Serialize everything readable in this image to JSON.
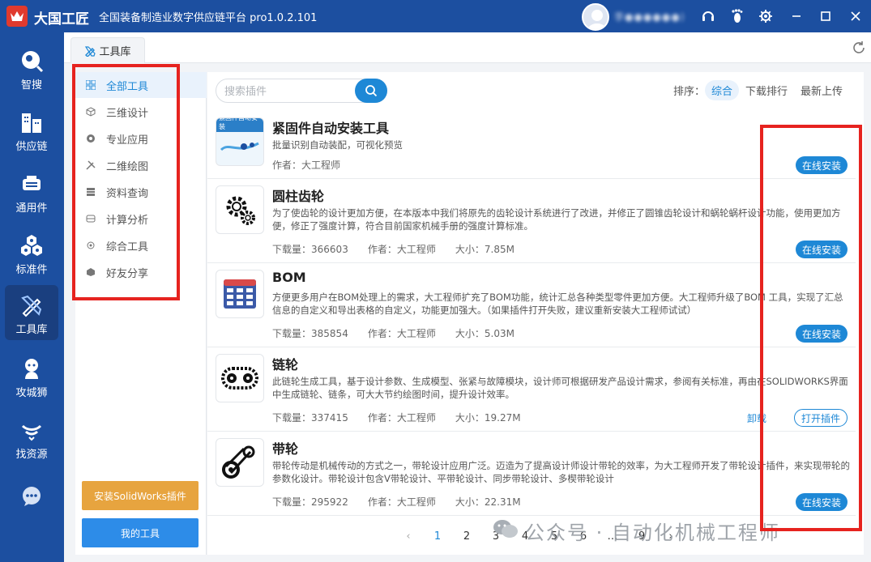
{
  "app": {
    "name": "大国工匠",
    "subtitle": "全国装备制造业数字供应链平台  pro1.0.2.101",
    "username": "李●●●●●●)"
  },
  "icons": {
    "logo": "crown-logo",
    "headset": "headset-icon",
    "footprint": "footprint-icon",
    "settings": "gear-icon",
    "minimize": "minimize-icon",
    "maximize": "maximize-icon",
    "close": "close-icon"
  },
  "sidebar": {
    "items": [
      {
        "label": "智搜",
        "icon": "search-bubble-icon"
      },
      {
        "label": "供应链",
        "icon": "buildings-icon"
      },
      {
        "label": "通用件",
        "icon": "component-icon"
      },
      {
        "label": "标准件",
        "icon": "hexagon-nuts-icon"
      },
      {
        "label": "工具库",
        "icon": "ruler-pencil-icon"
      },
      {
        "label": "攻城狮",
        "icon": "mascot-icon"
      },
      {
        "label": "找资源",
        "icon": "resource-icon"
      },
      {
        "label": "",
        "icon": "chat-icon"
      }
    ]
  },
  "tab": {
    "label": "工具库"
  },
  "categories": [
    {
      "label": "全部工具",
      "icon": "grid-icon"
    },
    {
      "label": "三维设计",
      "icon": "cube-icon"
    },
    {
      "label": "专业应用",
      "icon": "aperture-icon"
    },
    {
      "label": "二维绘图",
      "icon": "tools-icon"
    },
    {
      "label": "资料查询",
      "icon": "list-icon"
    },
    {
      "label": "计算分析",
      "icon": "calculator-icon"
    },
    {
      "label": "综合工具",
      "icon": "gear-small-icon"
    },
    {
      "label": "好友分享",
      "icon": "share-icon"
    }
  ],
  "buttons": {
    "install_solidworks": "安装SolidWorks插件",
    "my_tools": "我的工具"
  },
  "search": {
    "placeholder": "搜索插件"
  },
  "sort": {
    "label": "排序：",
    "options": [
      "综合",
      "下载排行",
      "最新上传"
    ]
  },
  "labels": {
    "downloads": "下载量：",
    "author": "作者：",
    "size": "大小：",
    "uninstall": "卸载"
  },
  "items": [
    {
      "name": "紧固件自动安装工具",
      "desc": "批量识别自动装配，可视化预览",
      "downloads": "",
      "author": "大工程师",
      "size": "",
      "action": "在线安装",
      "thumb": "fastener-thumb",
      "thumb_text": "紧固件自动安装"
    },
    {
      "name": "圆柱齿轮",
      "desc": "为了使齿轮的设计更加方便，在本版本中我们将原先的齿轮设计系统进行了改进，并修正了圆锥齿轮设计和蜗轮蜗杆设计功能，使用更加方便，修正了强度计算，符合目前国家机械手册的强度计算标准。",
      "downloads": "366603",
      "author": "大工程师",
      "size": "7.85M",
      "action": "在线安装",
      "thumb": "gear-thumb"
    },
    {
      "name": "BOM",
      "desc": "方便更多用户在BOM处理上的需求，大工程师扩充了BOM功能，统计汇总各种类型零件更加方便。大工程师升级了BOM 工具，实现了汇总信息的自定义和导出表格的自定义，功能更加强大。（如果插件打开失败，建议重新安装大工程师试试）",
      "downloads": "385854",
      "author": "大工程师",
      "size": "5.03M",
      "action": "在线安装",
      "thumb": "table-thumb"
    },
    {
      "name": "链轮",
      "desc": "此链轮生成工具，基于设计参数、生成模型、张紧与故障模块，设计师可根据研发产品设计需求，参阅有关标准，再由在SOLIDWORKS界面中生成链轮、链条，可大大节约绘图时间，提升设计效率。",
      "downloads": "337415",
      "author": "大工程师",
      "size": "19.27M",
      "action": "打开插件",
      "uninstall": true,
      "thumb": "chain-thumb"
    },
    {
      "name": "带轮",
      "desc": "带轮传动是机械传动的方式之一，带轮设计应用广泛。迈造为了提高设计师设计带轮的效率，为大工程师开发了带轮设计插件，来实现带轮的参数化设计。带轮设计包含V带轮设计、平带轮设计、同步带轮设计、多楔带轮设计",
      "downloads": "295922",
      "author": "大工程师",
      "size": "22.31M",
      "action": "在线安装",
      "thumb": "belt-thumb"
    }
  ],
  "pagination": {
    "prev": "‹",
    "pages": [
      "1",
      "2",
      "3",
      "4",
      "5",
      "6",
      "…",
      "9"
    ],
    "next": "›",
    "current": "1"
  },
  "watermark": {
    "text": "公众号 · 自动化机械工程师",
    "icon": "wechat-icon"
  },
  "colors": {
    "header": "#1c4fa0",
    "accent": "#1e88d6",
    "install_button": "#e7a43f",
    "my_tools_button": "#2d8ce8",
    "highlight_box": "#e6231f"
  }
}
